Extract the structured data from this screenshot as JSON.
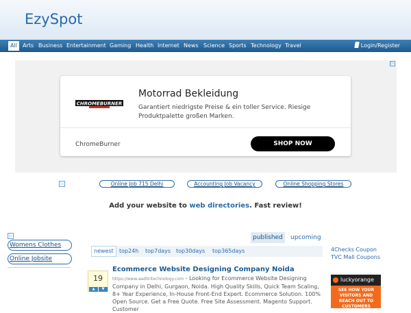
{
  "site": {
    "logo": "EzySpot"
  },
  "nav": {
    "items": [
      "All",
      "Arts",
      "Business",
      "Entertainment",
      "Gaming",
      "Health",
      "Internet",
      "News",
      "Science",
      "Sports",
      "Technology",
      "Travel"
    ],
    "active": "All",
    "login_label": "Login/Register"
  },
  "ad": {
    "title": "Motorrad Bekleidung",
    "description": "Garantiert niedrigste Preise & ein toller Service. Riesige Produktpalette großen Marken.",
    "logo_text": "CHROMEBURNER",
    "brand": "ChromeBurner",
    "cta": "SHOP NOW",
    "close_glyph": "▷"
  },
  "link_unit": {
    "links": [
      "Online Job 715 Delhi",
      "Accounting Job Vacancy",
      "Online Shopping Stores"
    ]
  },
  "promo": {
    "prefix": "Add your website to ",
    "link": "web directories",
    "suffix": ". Fast review!"
  },
  "left_ads": {
    "links": [
      "Womens Clothes",
      "Online Jobsite"
    ]
  },
  "publish_tabs": [
    "published",
    "upcoming"
  ],
  "sort_tabs": [
    "newest",
    "top24h",
    "top7days",
    "top30days",
    "top365days"
  ],
  "story": {
    "votes": "19",
    "title": "Ecommerce Website Designing Company Noida",
    "url": "https://www.aaditritechnology.com",
    "body": " - Looking for Ecommerce Website Designing Company in Delhi, Gurgaon, Noida. High Quality Skills, Quick Team Scaling, 8+ Year Experience, In-House Front-End Expert. Ecommerce Solution. 100% Open Source. Get a Free Quote. Free Site Assessment. Magento Support. Customer"
  },
  "right_links": [
    "4Checks Coupon",
    "TVC Mall Coupons"
  ],
  "right_banner": {
    "brand": "luckyorange",
    "text": "SEE HOW YOUR VISITORS AND REACH OUT TO CUSTOMERS"
  },
  "colors": {
    "nav_bg": "#1d5a8e",
    "link": "#2a6aa8",
    "cta_bg": "#000000",
    "banner_orange": "#f26b1d"
  }
}
